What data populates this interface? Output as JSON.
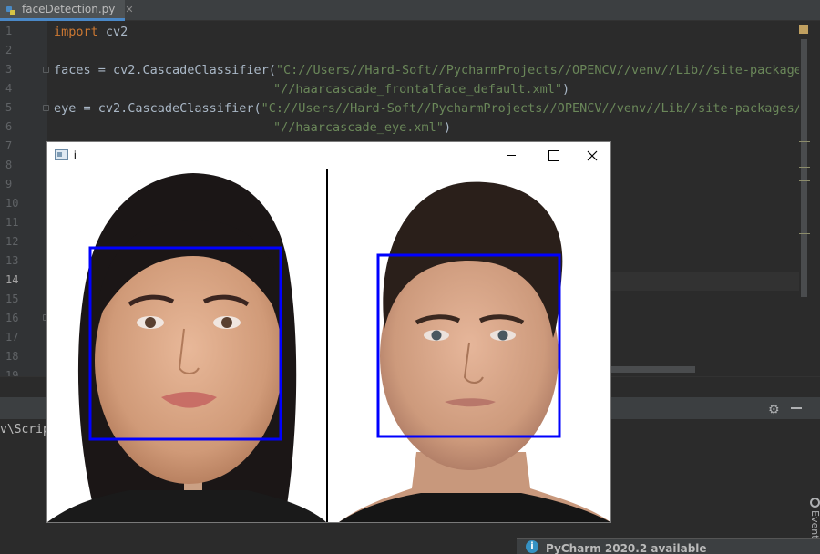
{
  "editor_tab": {
    "filename": "faceDetection.py",
    "close_glyph": "✕",
    "icon": "python-file-icon"
  },
  "line_numbers": [
    "1",
    "2",
    "3",
    "4",
    "5",
    "6",
    "7",
    "8",
    "9",
    "10",
    "11",
    "12",
    "13",
    "14",
    "15",
    "16",
    "17",
    "18",
    "19"
  ],
  "current_line": "14",
  "code": {
    "l1_kw": "import",
    "l1_rest": " cv2",
    "l3_code": "faces = cv2.CascadeClassifier(",
    "l3_str": "\"C://Users//Hard-Soft//PycharmProjects//OPENCV//venv//Lib//site-packages//c",
    "l4_str": "\"//haarcascade_frontalface_default.xml\"",
    "l4_close": ")",
    "l5_code": "eye = cv2.CascadeClassifier(",
    "l5_str": "\"C://Users//Hard-Soft//PycharmProjects//OPENCV//venv//Lib//site-packages//cv",
    "l6_str": "\"//haarcascade_eye.xml\"",
    "l6_close": ")"
  },
  "run_panel": {
    "console_text": "v\\Scrip",
    "gear_icon": "⚙"
  },
  "event_log": {
    "label": "Event"
  },
  "notification": {
    "text": "PyCharm 2020.2 available",
    "icon_glyph": "i"
  },
  "cv_window": {
    "title": "i",
    "detection_color": "#0000ff"
  },
  "colors": {
    "keyword": "#cc7832",
    "string": "#6a8759",
    "text": "#a9b7c6",
    "accent": "#4a88c7"
  }
}
